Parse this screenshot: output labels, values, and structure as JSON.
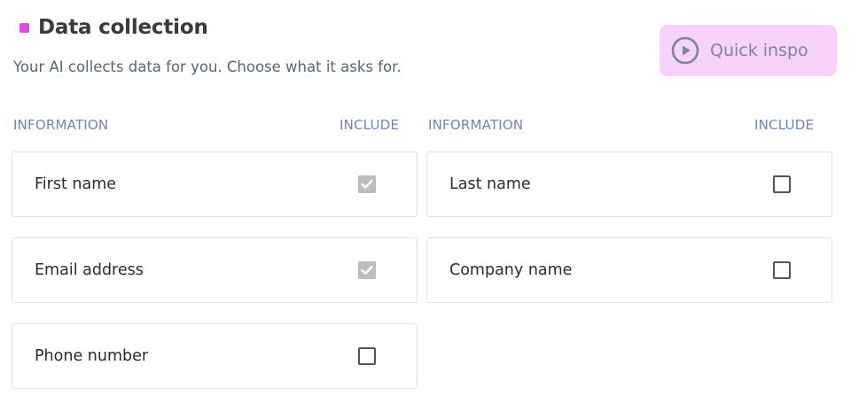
{
  "header": {
    "title": "Data collection",
    "subtitle": "Your AI collects data for you. Choose what it asks for.",
    "accent_color": "#d94fe6"
  },
  "quick_inspo": {
    "label": "Quick inspo",
    "icon": "play-circle-icon",
    "background": "#f7d2fb"
  },
  "columns": [
    {
      "information_label": "INFORMATION",
      "include_label": "INCLUDE"
    },
    {
      "information_label": "INFORMATION",
      "include_label": "INCLUDE"
    }
  ],
  "fields": [
    {
      "label": "First name",
      "included": true,
      "locked": true
    },
    {
      "label": "Last name",
      "included": false,
      "locked": false
    },
    {
      "label": "Email address",
      "included": true,
      "locked": true
    },
    {
      "label": "Company name",
      "included": false,
      "locked": false
    },
    {
      "label": "Phone number",
      "included": false,
      "locked": false
    }
  ]
}
